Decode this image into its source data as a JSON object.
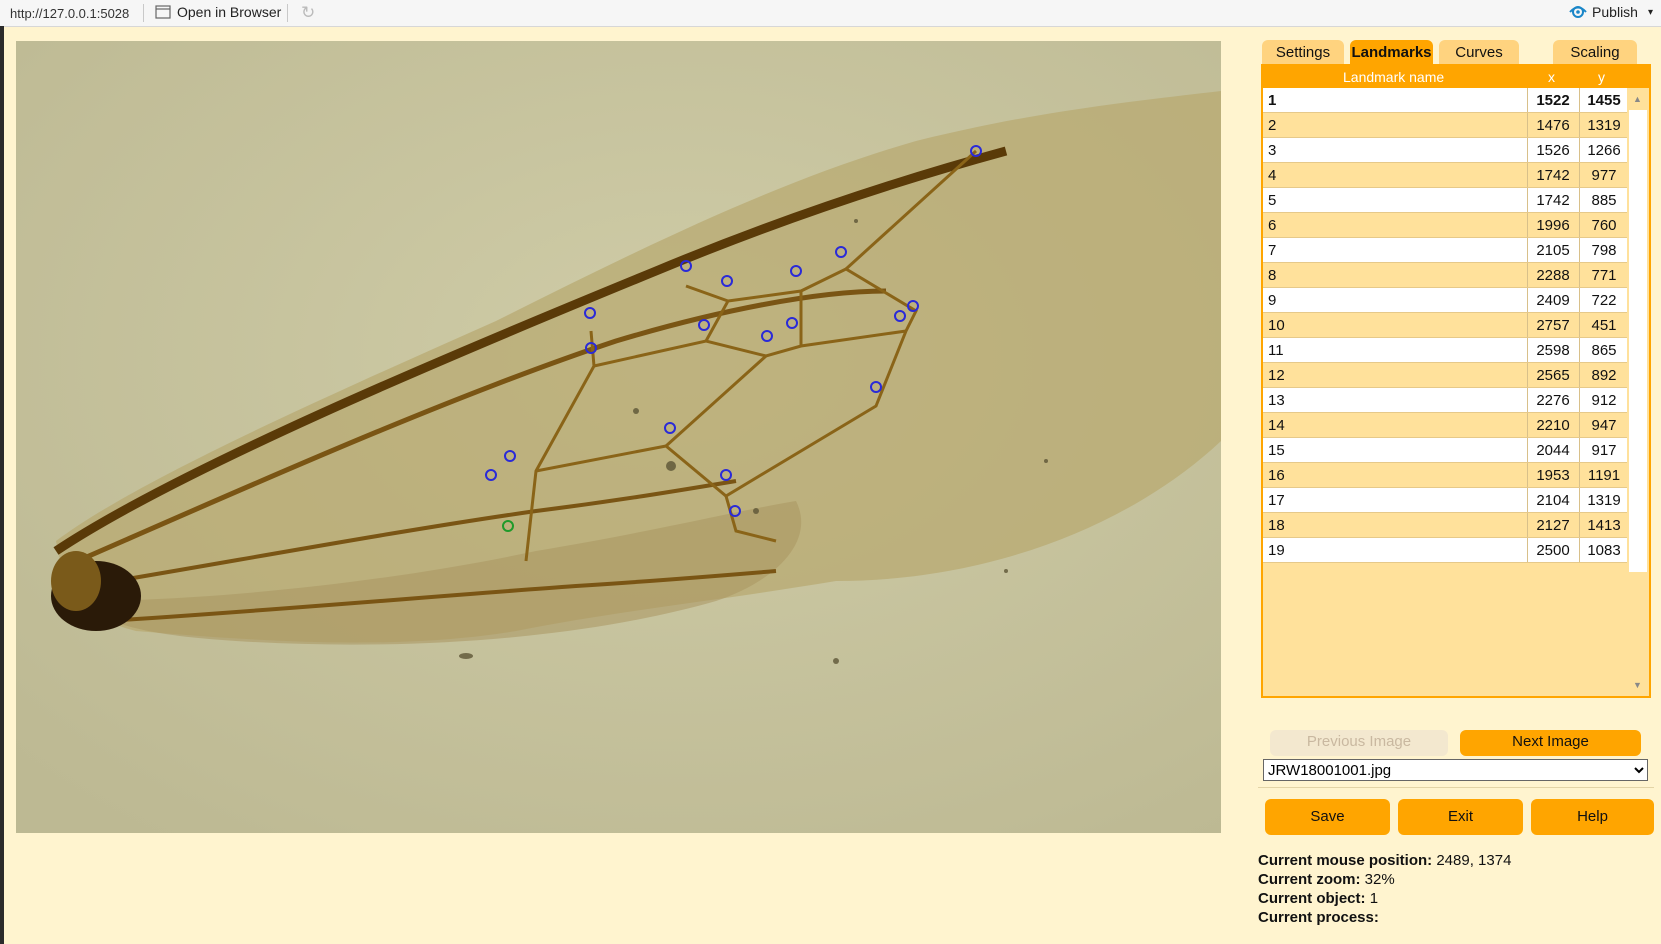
{
  "topbar": {
    "url": "http://127.0.0.1:5028",
    "open_in_browser": "Open in Browser",
    "publish": "Publish"
  },
  "tabs": [
    {
      "label": "Settings",
      "active": false
    },
    {
      "label": "Landmarks",
      "active": true
    },
    {
      "label": "Curves",
      "active": false
    },
    {
      "label": "Scaling",
      "active": false
    }
  ],
  "table": {
    "headers": {
      "name": "Landmark name",
      "x": "x",
      "y": "y"
    },
    "rows": [
      {
        "name": "1",
        "x": "1522",
        "y": "1455"
      },
      {
        "name": "2",
        "x": "1476",
        "y": "1319"
      },
      {
        "name": "3",
        "x": "1526",
        "y": "1266"
      },
      {
        "name": "4",
        "x": "1742",
        "y": "977"
      },
      {
        "name": "5",
        "x": "1742",
        "y": "885"
      },
      {
        "name": "6",
        "x": "1996",
        "y": "760"
      },
      {
        "name": "7",
        "x": "2105",
        "y": "798"
      },
      {
        "name": "8",
        "x": "2288",
        "y": "771"
      },
      {
        "name": "9",
        "x": "2409",
        "y": "722"
      },
      {
        "name": "10",
        "x": "2757",
        "y": "451"
      },
      {
        "name": "11",
        "x": "2598",
        "y": "865"
      },
      {
        "name": "12",
        "x": "2565",
        "y": "892"
      },
      {
        "name": "13",
        "x": "2276",
        "y": "912"
      },
      {
        "name": "14",
        "x": "2210",
        "y": "947"
      },
      {
        "name": "15",
        "x": "2044",
        "y": "917"
      },
      {
        "name": "16",
        "x": "1953",
        "y": "1191"
      },
      {
        "name": "17",
        "x": "2104",
        "y": "1319"
      },
      {
        "name": "18",
        "x": "2127",
        "y": "1413"
      },
      {
        "name": "19",
        "x": "2500",
        "y": "1083"
      }
    ]
  },
  "buttons": {
    "previous_image": "Previous Image",
    "next_image": "Next Image",
    "save": "Save",
    "exit": "Exit",
    "help": "Help"
  },
  "file_select": {
    "selected": "JRW18001001.jpg"
  },
  "status": {
    "mouse_label": "Current mouse position:",
    "mouse_value": "2489, 1374",
    "zoom_label": "Current zoom:",
    "zoom_value": "32%",
    "object_label": "Current object:",
    "object_value": "1",
    "process_label": "Current process:",
    "process_value": ""
  },
  "colors": {
    "accent": "#ffa500",
    "panel_bg": "#fff4cf",
    "row_alt": "#ffe19b",
    "landmark_marker": "#2a2ad8",
    "active_landmark_marker": "#1f9a2a"
  }
}
